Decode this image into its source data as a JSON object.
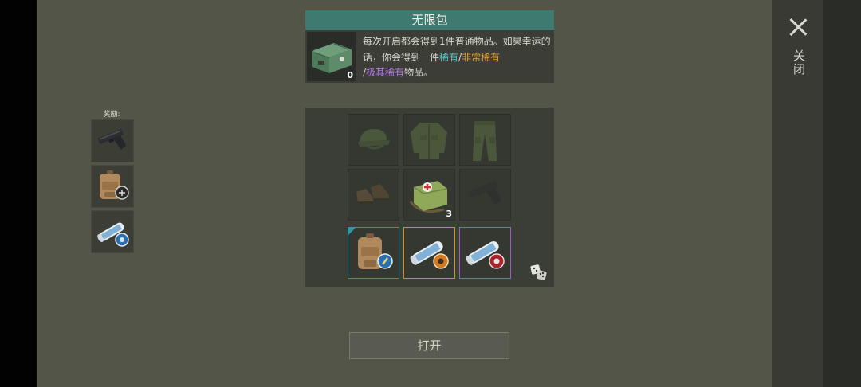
{
  "close": {
    "label": "关闭",
    "icon": "close-icon"
  },
  "rewards": {
    "title": "奖励:",
    "items": [
      {
        "icon": "pistol-icon"
      },
      {
        "icon": "backpack-blueprint-icon"
      },
      {
        "icon": "blueprint-scroll-icon"
      }
    ]
  },
  "info": {
    "title": "无限包",
    "count": "0",
    "icon": "supply-crate-icon",
    "text_plain": "每次开启都会得到1件普通物品。如果幸运的话，你会得到一件",
    "rare": "稀有",
    "sep1": "/",
    "very_rare": "非常稀有",
    "sep2": "/",
    "ultra_rare": "极其稀有",
    "text_end": "物品。"
  },
  "grid": {
    "slots": [
      {
        "icon": "cap-icon",
        "dim": true
      },
      {
        "icon": "jacket-icon",
        "dim": true
      },
      {
        "icon": "pants-icon",
        "dim": true
      },
      {
        "icon": "boots-icon",
        "dim": true
      },
      {
        "icon": "medkit-bag-icon",
        "dim": false,
        "count": "3"
      },
      {
        "icon": "pistol-icon",
        "dim": true
      },
      {
        "icon": "backpack-blueprint-icon",
        "rarity": "rare"
      },
      {
        "icon": "blueprint-scroll-icon",
        "rarity": "very-rare"
      },
      {
        "icon": "blueprint-scroll-icon",
        "rarity": "ultra-rare"
      }
    ],
    "dice_icon": "dice-icon"
  },
  "open_button": {
    "label": "打开"
  },
  "colors": {
    "rare": "#5cc6c8",
    "very_rare": "#e0a03a",
    "ultra_rare": "#b47ae6",
    "title_bar": "#3f7a70"
  }
}
